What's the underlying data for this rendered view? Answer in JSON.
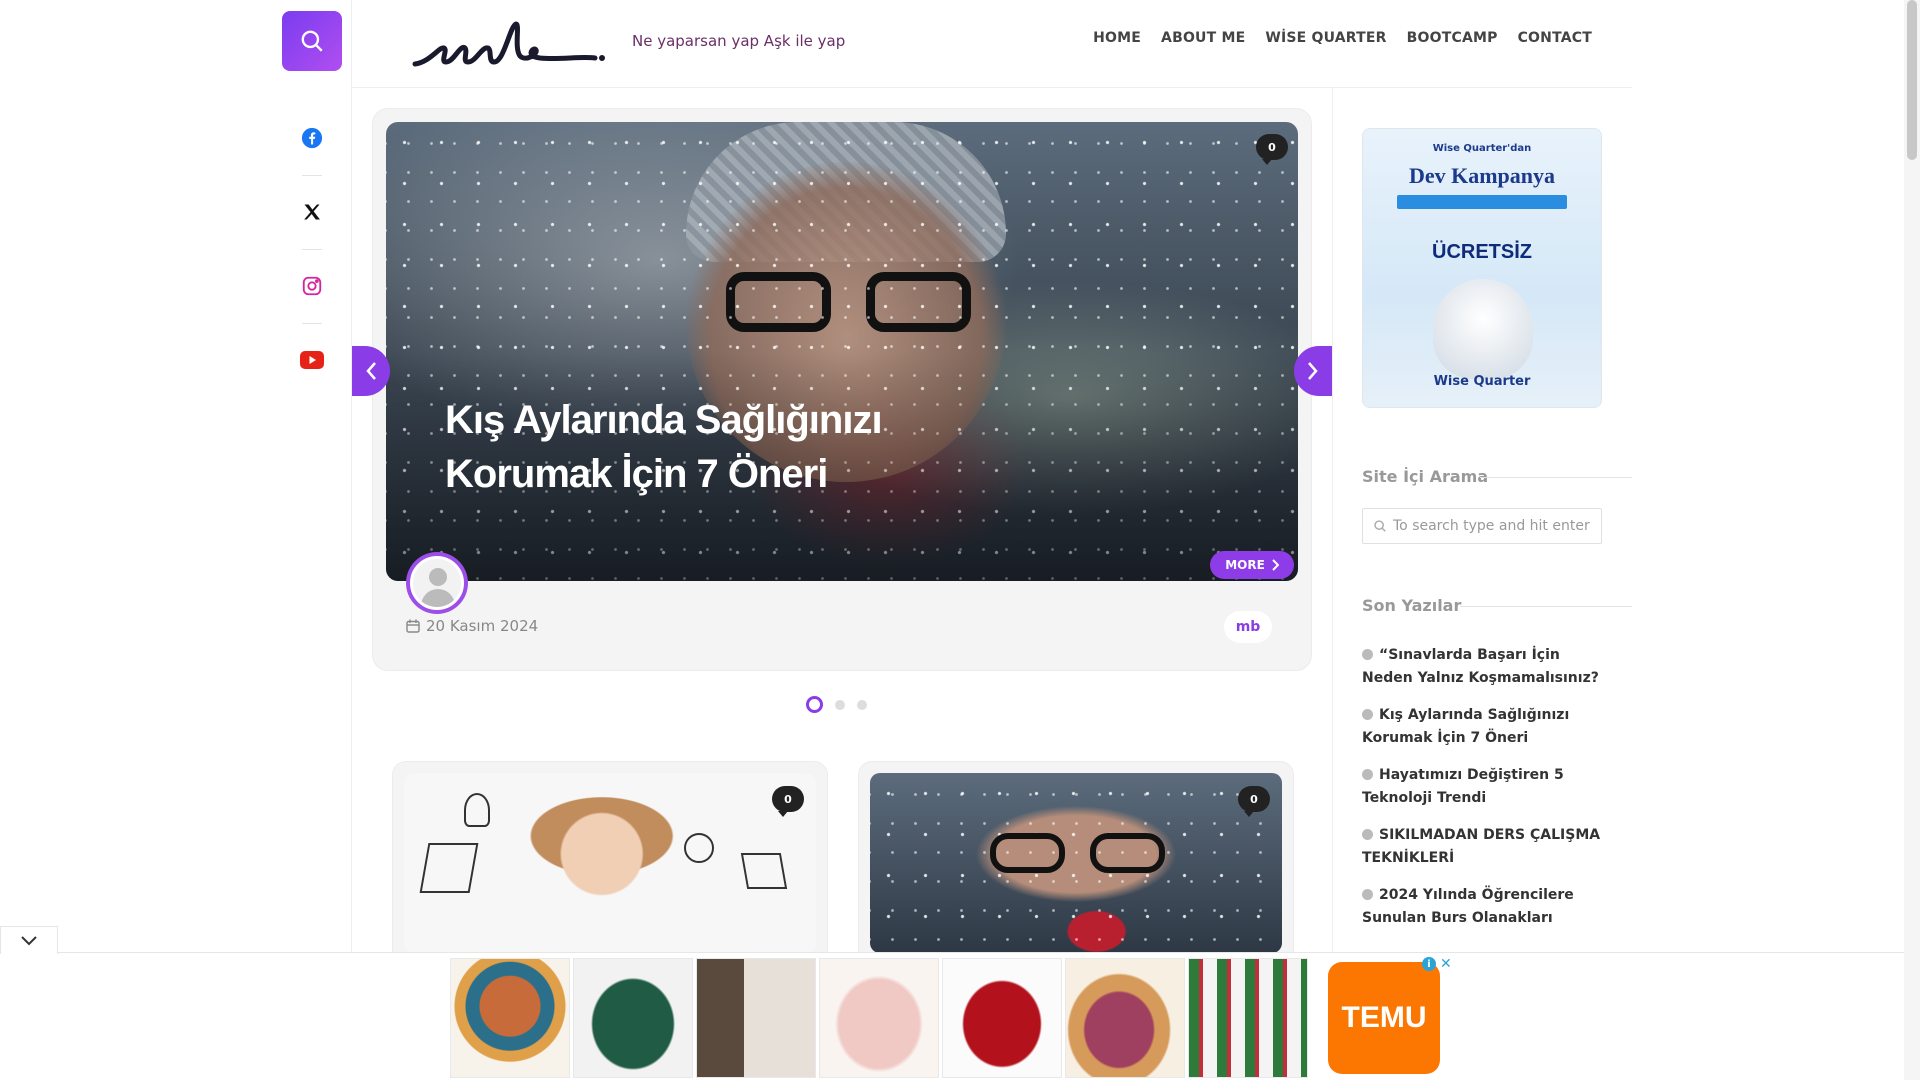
{
  "header": {
    "tagline": "Ne yaparsan yap Aşk ile yap",
    "nav": [
      "HOME",
      "ABOUT ME",
      "WİSE QUARTER",
      "BOOTCAMP",
      "CONTACT"
    ]
  },
  "social": {
    "icons": [
      "facebook-icon",
      "x-icon",
      "instagram-icon",
      "youtube-icon"
    ]
  },
  "slider": {
    "title_line1": "Kış Aylarında Sağlığınızı",
    "title_line2": "Korumak İçin 7 Öneri",
    "comment_count": "0",
    "more_label": "MORE",
    "date": "20 Kasım 2024",
    "author": "mb",
    "active_slide": 1,
    "slide_count": 3
  },
  "posts": [
    {
      "comment_count": "0"
    },
    {
      "comment_count": "0"
    }
  ],
  "sidebar": {
    "ad": {
      "sub": "Wise Quarter'dan",
      "title": "Dev Kampanya",
      "free": "ÜCRETSİZ",
      "brand": "Wise Quarter"
    },
    "search_title": "Site İçi Arama",
    "search_placeholder": "To search type and hit enter",
    "recent_title": "Son Yazılar",
    "recent_posts": [
      "“Sınavlarda Başarı İçin Neden Yalnız Koşmamalısınız?",
      "Kış Aylarında Sağlığınızı Korumak İçin 7 Öneri",
      "Hayatımızı Değiştiren 5 Teknoloji Trendi",
      "SIKILMADAN DERS ÇALIŞMA TEKNİKLERİ",
      "2024 Yılında Öğrencilere Sunulan Burs Olanakları"
    ]
  },
  "bottom_ad": {
    "brand": "TEMU"
  },
  "colors": {
    "accent": "#8a3de6",
    "tagline": "#6b2e67",
    "temu": "#fb7701"
  }
}
